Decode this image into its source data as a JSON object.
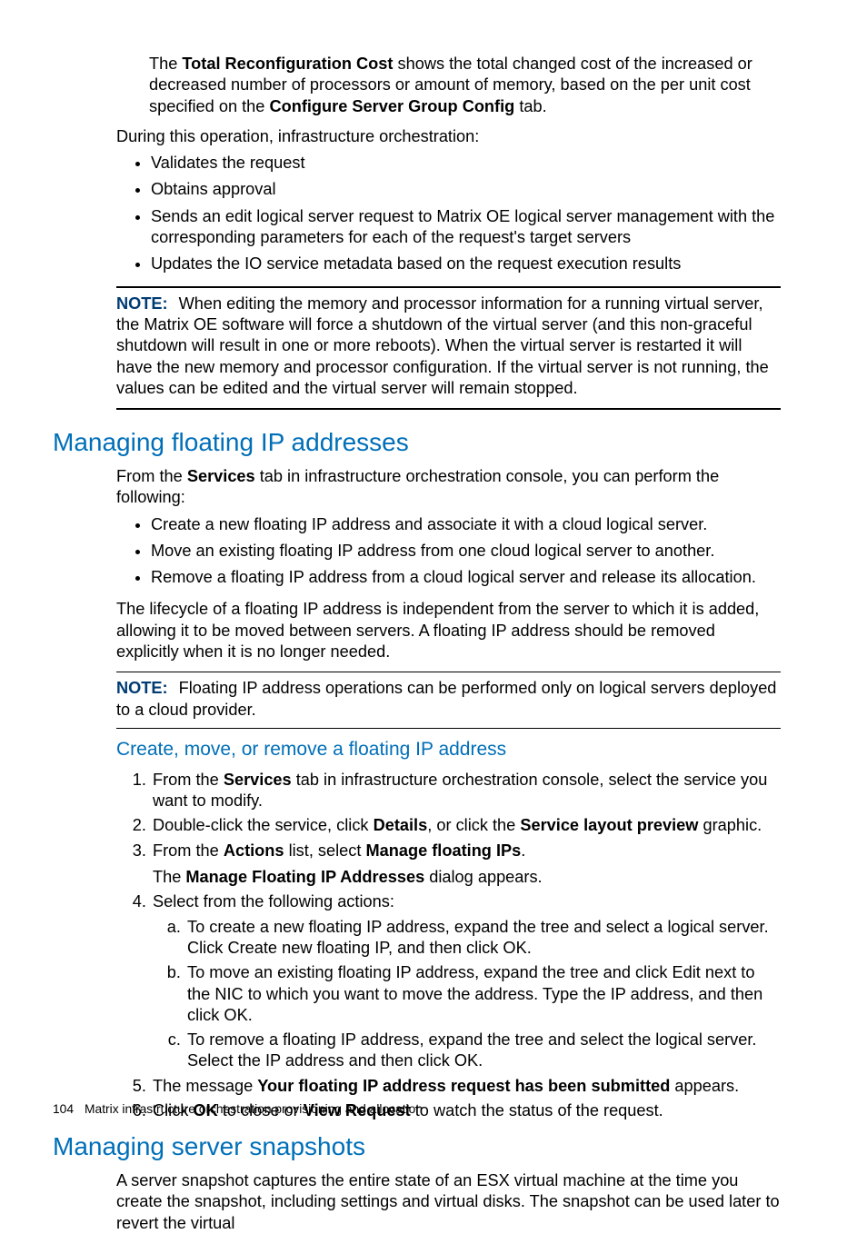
{
  "top": {
    "p1_a": "The ",
    "p1_b": "Total Reconfiguration Cost",
    "p1_c": " shows the total changed cost of the increased or decreased number of processors or amount of memory, based on the per unit cost specified on the ",
    "p1_d": "Configure Server Group Config",
    "p1_e": " tab.",
    "p2": "During this operation, infrastructure orchestration:",
    "bullets": [
      "Validates the request",
      "Obtains approval",
      "Sends an edit logical server request to Matrix OE logical server management with the corresponding parameters for each of the request's target servers",
      "Updates the IO service metadata based on the request execution results"
    ],
    "note_label": "NOTE:",
    "note_text": "When editing the memory and processor information for a running virtual server, the Matrix OE software will force a shutdown of the virtual server (and this non-graceful shutdown will result in one or more reboots). When the virtual server is restarted it will have the new memory and processor configuration. If the virtual server is not running, the values can be edited and the virtual server will remain stopped."
  },
  "sec1": {
    "title": "Managing floating IP addresses",
    "intro_a": "From the ",
    "intro_b": "Services",
    "intro_c": " tab in infrastructure orchestration console, you can perform the following:",
    "bullets": [
      "Create a new floating IP address and associate it with a cloud logical server.",
      "Move an existing floating IP address from one cloud logical server to another.",
      "Remove a floating IP address from a cloud logical server and release its allocation."
    ],
    "p2": "The lifecycle of a floating IP address is independent from the server to which it is added, allowing it to be moved between servers. A floating IP address should be removed explicitly when it is no longer needed.",
    "note_label": "NOTE:",
    "note_text": "Floating IP address operations can be performed only on logical servers deployed to a cloud provider.",
    "sub": {
      "title": "Create, move, or remove a floating IP address",
      "steps": {
        "s1_a": "From the ",
        "s1_b": "Services",
        "s1_c": " tab in infrastructure orchestration console, select the service you want to modify.",
        "s2_a": "Double-click the service, click ",
        "s2_b": "Details",
        "s2_c": ", or click the ",
        "s2_d": "Service layout preview",
        "s2_e": " graphic.",
        "s3_a": "From the ",
        "s3_b": "Actions",
        "s3_c": " list, select ",
        "s3_d": "Manage floating IPs",
        "s3_e": ".",
        "s3_after_a": "The ",
        "s3_after_b": "Manage Floating IP Addresses",
        "s3_after_c": " dialog appears.",
        "s4": "Select from the following actions:",
        "sub_a": "To create a new floating IP address, expand the tree and select a logical server. Click Create new floating IP, and then click OK.",
        "sub_b": "To move an existing floating IP address, expand the tree and click Edit next to the NIC to which you want to move the address. Type the IP address, and then click OK.",
        "sub_c": "To remove a floating IP address, expand the tree and select the logical server. Select the IP address and then click OK.",
        "s5_a": "The message ",
        "s5_b": "Your floating IP address request has been submitted",
        "s5_c": " appears.",
        "s6_a": "Click ",
        "s6_b": "OK",
        "s6_c": " to close or ",
        "s6_d": "View Request",
        "s6_e": " to watch the status of the request."
      }
    }
  },
  "sec2": {
    "title": "Managing server snapshots",
    "p1": "A server snapshot captures the entire state of an ESX virtual machine at the time you create the snapshot, including settings and virtual disks. The snapshot can be used later to revert the virtual"
  },
  "footer": {
    "page": "104",
    "chapter": "Matrix infrastructure orchestration provisioning and allocation"
  }
}
